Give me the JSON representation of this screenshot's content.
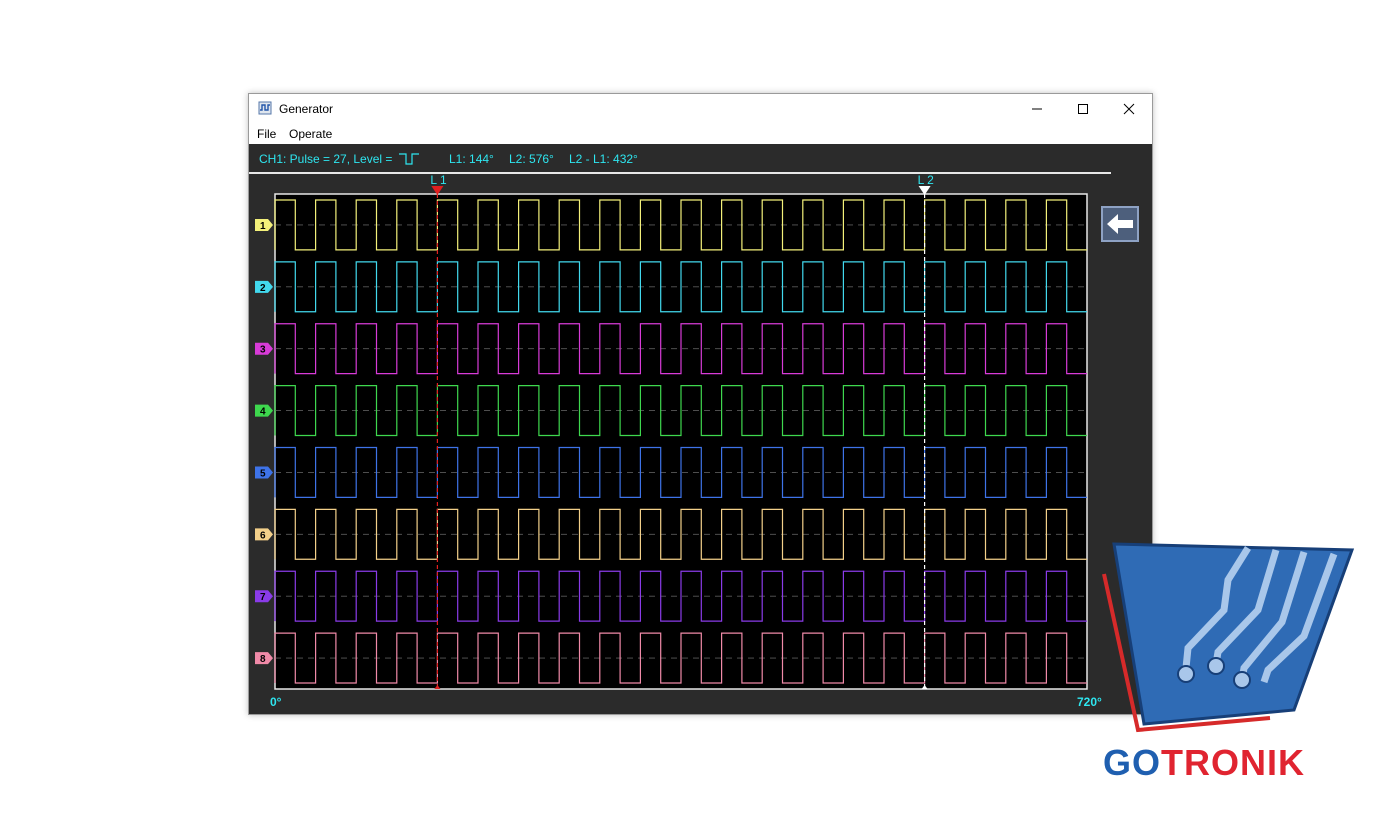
{
  "window": {
    "title": "Generator",
    "icon": "generator-app-icon"
  },
  "menu": {
    "items": [
      "File",
      "Operate"
    ]
  },
  "status": {
    "ch1": "CH1: Pulse = 27, Level =",
    "l1": "L1: 144°",
    "l2": "L2: 576°",
    "diff": "L2 - L1: 432°"
  },
  "cursors": {
    "l1": {
      "label": "L 1",
      "position_deg": 144,
      "color": "#e02020"
    },
    "l2": {
      "label": "L 2",
      "position_deg": 576,
      "color": "#ffffff"
    }
  },
  "axis": {
    "start_label": "0°",
    "end_label": "720°",
    "range_deg": [
      0,
      720
    ]
  },
  "channels": [
    {
      "id": "1",
      "color": "#f3f07a",
      "periods": 20
    },
    {
      "id": "2",
      "color": "#42d9ee",
      "periods": 20
    },
    {
      "id": "3",
      "color": "#d83bd8",
      "periods": 20
    },
    {
      "id": "4",
      "color": "#3ed84e",
      "periods": 20
    },
    {
      "id": "5",
      "color": "#3e73e8",
      "periods": 20
    },
    {
      "id": "6",
      "color": "#f3d08a",
      "periods": 20
    },
    {
      "id": "7",
      "color": "#8a3be8",
      "periods": 20
    },
    {
      "id": "8",
      "color": "#f08aa8",
      "periods": 20
    }
  ],
  "logo": {
    "text_go": "GO",
    "text_tronik": "TRONIK",
    "color_go": "#1f5fb0",
    "color_tronik": "#e02430"
  }
}
